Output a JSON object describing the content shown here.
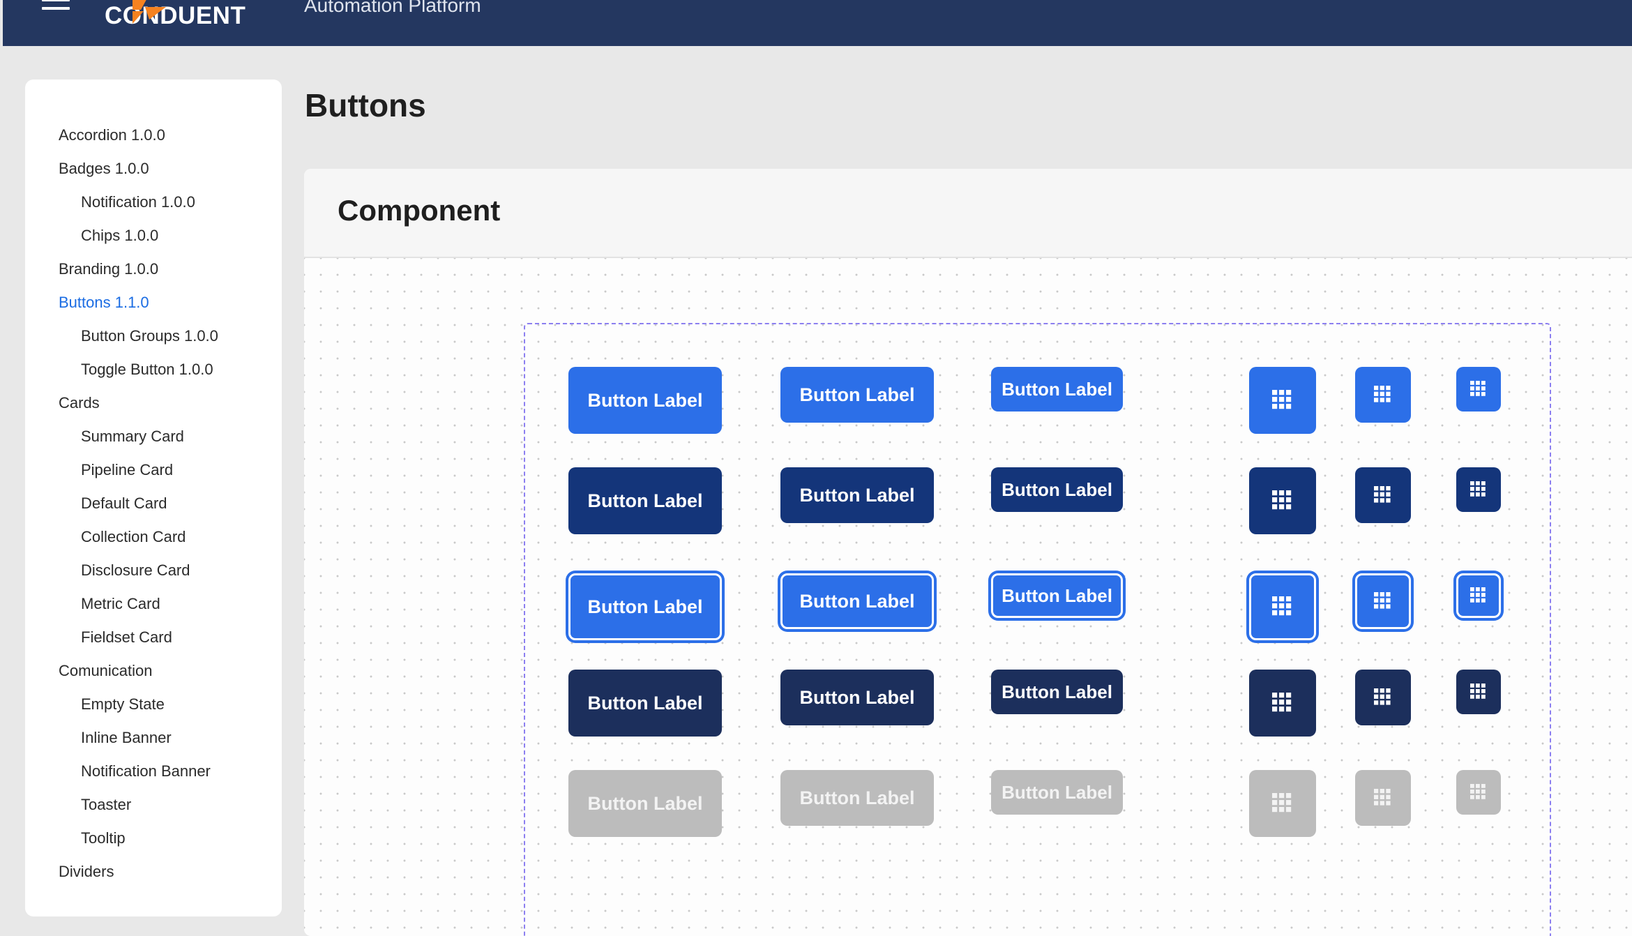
{
  "header": {
    "brand": "CONDUENT",
    "app_name": "Automation Platform",
    "background": "#243760"
  },
  "page": {
    "title": "Buttons"
  },
  "sidebar": {
    "items": [
      {
        "label": "Accordion 1.0.0",
        "level": 1
      },
      {
        "label": "Badges 1.0.0",
        "level": 1
      },
      {
        "label": "Notification 1.0.0",
        "level": 2
      },
      {
        "label": "Chips 1.0.0",
        "level": 2
      },
      {
        "label": "Branding 1.0.0",
        "level": 1
      },
      {
        "label": "Buttons 1.1.0",
        "level": 1,
        "active": true
      },
      {
        "label": "Button Groups 1.0.0",
        "level": 2
      },
      {
        "label": "Toggle Button 1.0.0",
        "level": 2
      },
      {
        "label": "Cards",
        "level": 1
      },
      {
        "label": "Summary Card",
        "level": 2
      },
      {
        "label": "Pipeline Card",
        "level": 2
      },
      {
        "label": "Default Card",
        "level": 2
      },
      {
        "label": "Collection Card",
        "level": 2
      },
      {
        "label": "Disclosure Card",
        "level": 2
      },
      {
        "label": "Metric Card",
        "level": 2
      },
      {
        "label": "Fieldset Card",
        "level": 2
      },
      {
        "label": "Comunication",
        "level": 1
      },
      {
        "label": "Empty State",
        "level": 2
      },
      {
        "label": "Inline Banner",
        "level": 2
      },
      {
        "label": "Notification Banner",
        "level": 2
      },
      {
        "label": "Toaster",
        "level": 2
      },
      {
        "label": "Tooltip",
        "level": 2
      },
      {
        "label": "Dividers",
        "level": 1
      }
    ]
  },
  "panel": {
    "title": "Component"
  },
  "buttons": {
    "label": "Button Label",
    "icon": "grid-icon",
    "states": [
      "primary",
      "pressed",
      "focus",
      "hover",
      "disabled"
    ],
    "sizes": [
      "large",
      "medium",
      "small"
    ],
    "colors": {
      "primary": "#2c6fe8",
      "pressed": "#14357a",
      "hover": "#1c2f5c",
      "disabled": "#bcbcbc",
      "frame_outline": "#8c7ff0",
      "active_nav": "#1a6ce3"
    }
  }
}
